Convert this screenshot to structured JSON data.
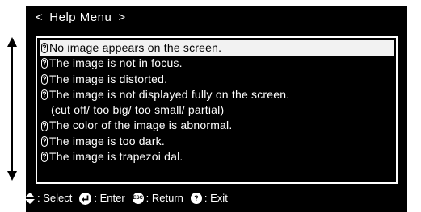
{
  "header": {
    "prev_arrow": "<",
    "title": "Help Menu",
    "next_arrow": ">"
  },
  "menu": {
    "items": [
      {
        "text": "No image appears on the screen.",
        "icon": "question-icon"
      },
      {
        "text": "The image is not in focus.",
        "icon": "question-icon"
      },
      {
        "text": "The image is distorted.",
        "icon": "question-icon"
      },
      {
        "text": "The image is not displayed fully on the screen.",
        "icon": "question-icon"
      },
      {
        "text": "(cut off/ too big/ too small/ partial)"
      },
      {
        "text": "The color of the image is abnormal.",
        "icon": "question-icon"
      },
      {
        "text": "The image is too dark.",
        "icon": "question-icon"
      },
      {
        "text": "The image is trapezoi dal.",
        "icon": "question-icon"
      }
    ],
    "selected_index": 0
  },
  "footer": {
    "select_label": ": Select",
    "enter_label": ": Enter",
    "return_label": ": Return",
    "exit_label": ": Exit",
    "esc_key": "ESC",
    "help_key": "?"
  },
  "colors": {
    "osd_background": "#000000",
    "text": "#ffffff",
    "highlight": "#f2f2f2"
  }
}
